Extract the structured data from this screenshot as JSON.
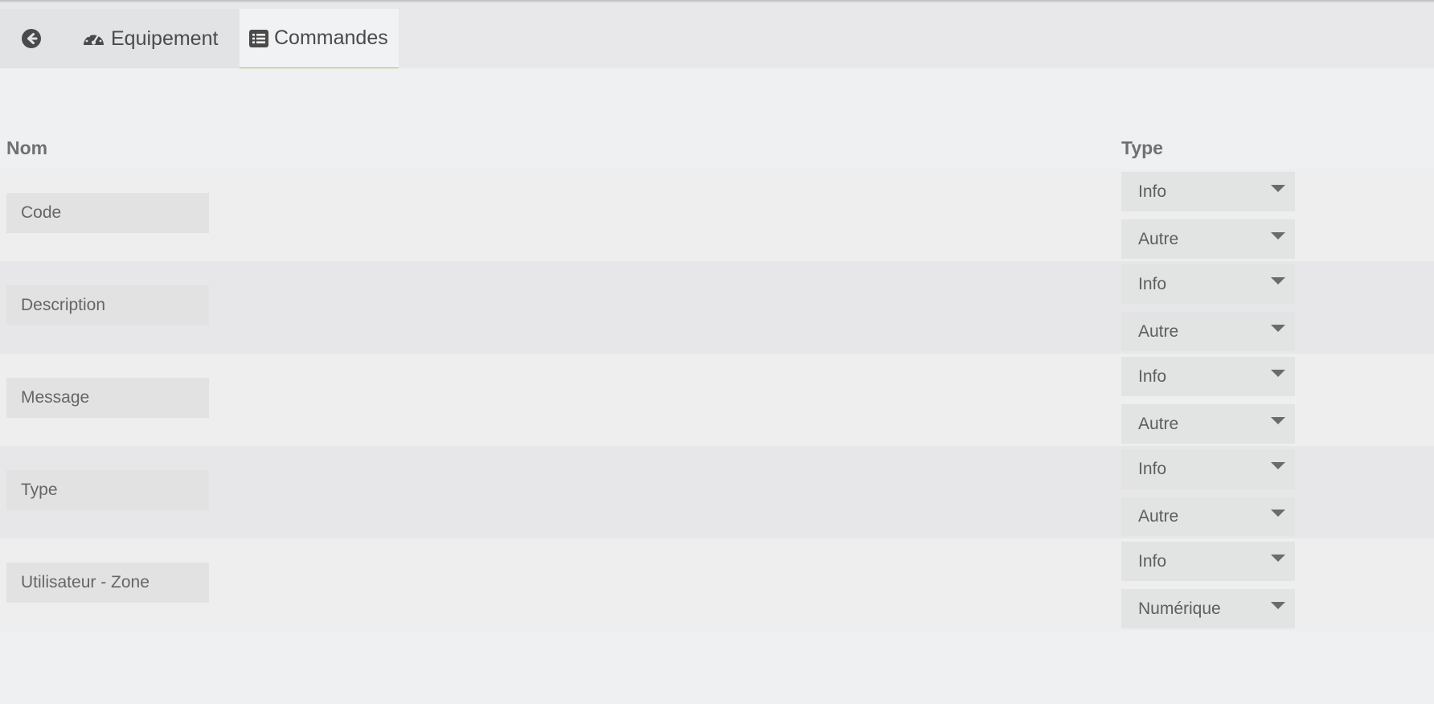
{
  "tabs": {
    "back_icon": "arrow-circle-left-icon",
    "equipement": {
      "label": "Equipement",
      "icon": "tachometer-icon"
    },
    "commandes": {
      "label": "Commandes",
      "icon": "list-alt-icon",
      "active": true
    }
  },
  "table": {
    "headers": {
      "name": "Nom",
      "type": "Type"
    },
    "rows": [
      {
        "name": "Code",
        "type": "Info",
        "subtype": "Autre"
      },
      {
        "name": "Description",
        "type": "Info",
        "subtype": "Autre"
      },
      {
        "name": "Message",
        "type": "Info",
        "subtype": "Autre"
      },
      {
        "name": "Type",
        "type": "Info",
        "subtype": "Autre"
      },
      {
        "name": "Utilisateur - Zone",
        "type": "Info",
        "subtype": "Numérique"
      }
    ]
  },
  "colors": {
    "accent": "#9cbf58",
    "background": "#eff0f2",
    "tabbar": "#e8e8ea"
  }
}
